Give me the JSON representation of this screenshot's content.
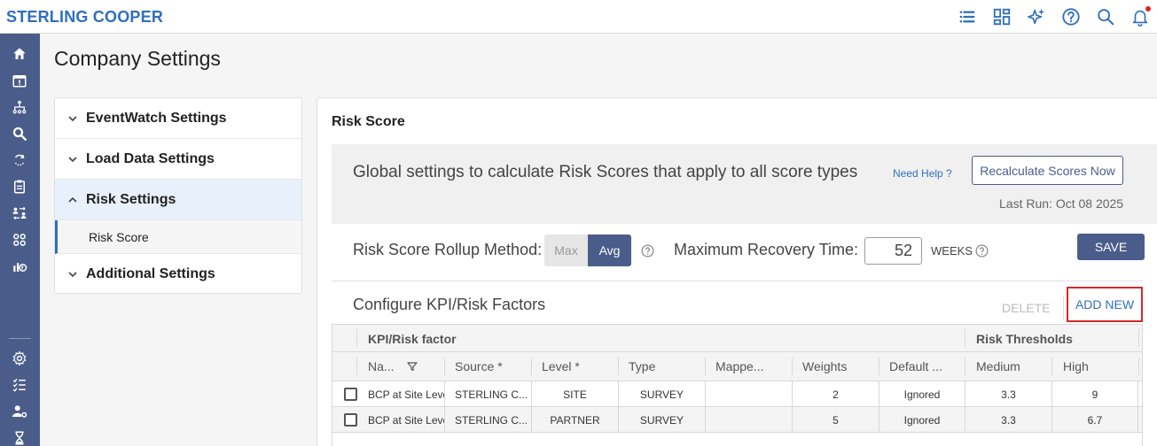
{
  "brand": "STERLING COOPER",
  "page_title": "Company Settings",
  "nav": {
    "items": [
      {
        "label": "EventWatch Settings"
      },
      {
        "label": "Load Data Settings"
      },
      {
        "label": "Risk Settings"
      },
      {
        "label": "Additional Settings"
      }
    ],
    "sub_item": "Risk Score"
  },
  "risk_score": {
    "section_title": "Risk Score",
    "global_text": "Global settings to calculate Risk Scores that apply to all score types",
    "help_link": "Need Help ?",
    "recalc_label": "Recalculate Scores Now",
    "last_run": "Last Run: Oct 08 2025",
    "rollup_label": "Risk Score Rollup Method:",
    "rollup_options": [
      "Max",
      "Avg"
    ],
    "rollup_selected": "Avg",
    "recovery_label": "Maximum Recovery Time:",
    "recovery_value": "52",
    "weeks_label": "WEEKS",
    "save_label": "SAVE"
  },
  "kpi": {
    "title": "Configure KPI/Risk Factors",
    "delete_label": "DELETE",
    "add_new_label": "ADD NEW",
    "group_headers": [
      "KPI/Risk factor",
      "Risk Thresholds"
    ],
    "columns": [
      "Na...",
      "Source *",
      "Level *",
      "Type",
      "Mappe...",
      "Weights",
      "Default ...",
      "Medium",
      "High"
    ],
    "rows": [
      {
        "name": "BCP at Site Level",
        "source": "STERLING C...",
        "level": "SITE",
        "type": "SURVEY",
        "mapped": "",
        "weights": "2",
        "default": "Ignored",
        "medium": "3.3",
        "high": "9"
      },
      {
        "name": "BCP at Site Level",
        "source": "STERLING C...",
        "level": "PARTNER",
        "type": "SURVEY",
        "mapped": "",
        "weights": "5",
        "default": "Ignored",
        "medium": "3.3",
        "high": "6.7"
      }
    ]
  },
  "colors": {
    "brand": "#2f6fbf",
    "sidebar": "#4a5d8a",
    "accent_red": "#d9262c"
  }
}
